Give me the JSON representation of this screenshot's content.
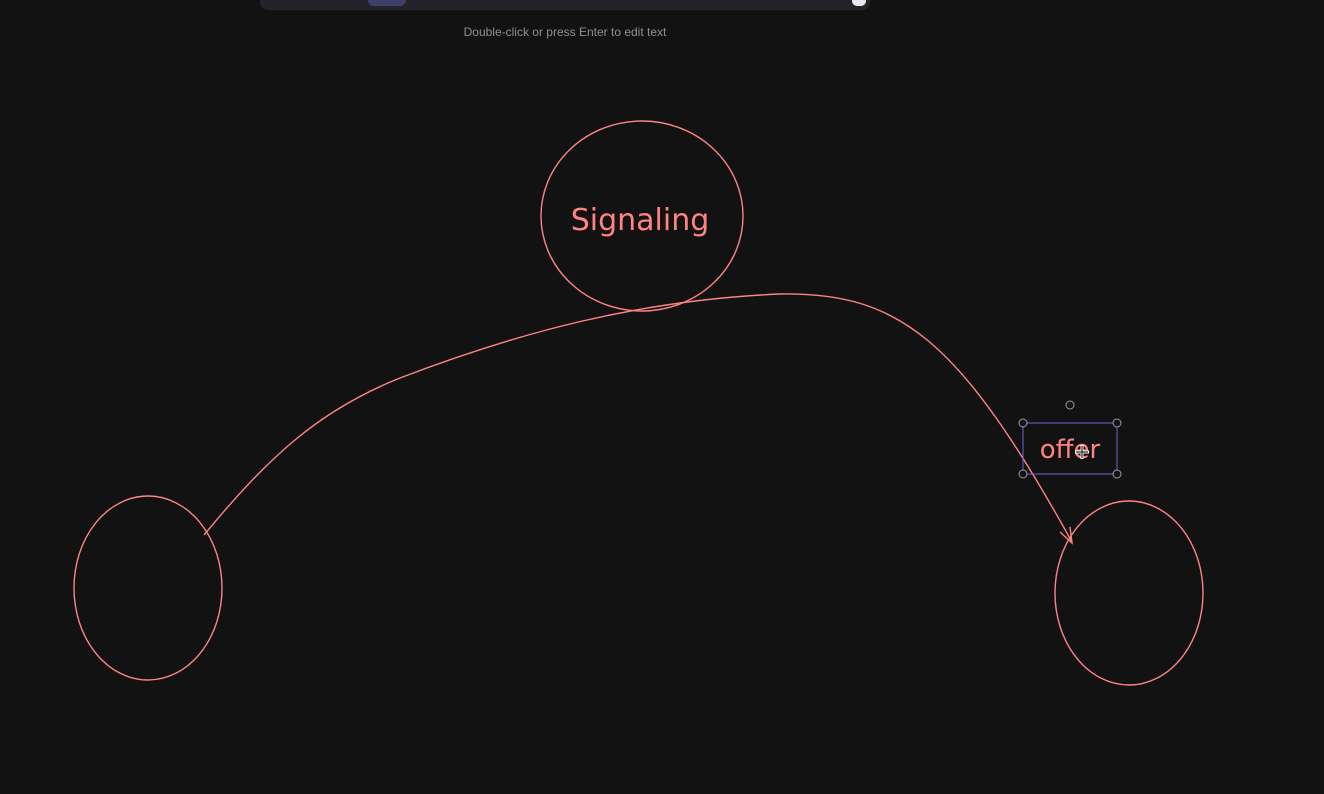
{
  "app": {
    "hint_text": "Double-click or press Enter to edit text"
  },
  "canvas": {
    "stroke_color": "#ff8383",
    "selection_color": "#6965db",
    "shapes": {
      "signaling_circle_label": "Signaling",
      "offer_label": "offer"
    }
  },
  "toolbar": {
    "active_tool": "selected-tool",
    "end_icon": "library-icon"
  }
}
